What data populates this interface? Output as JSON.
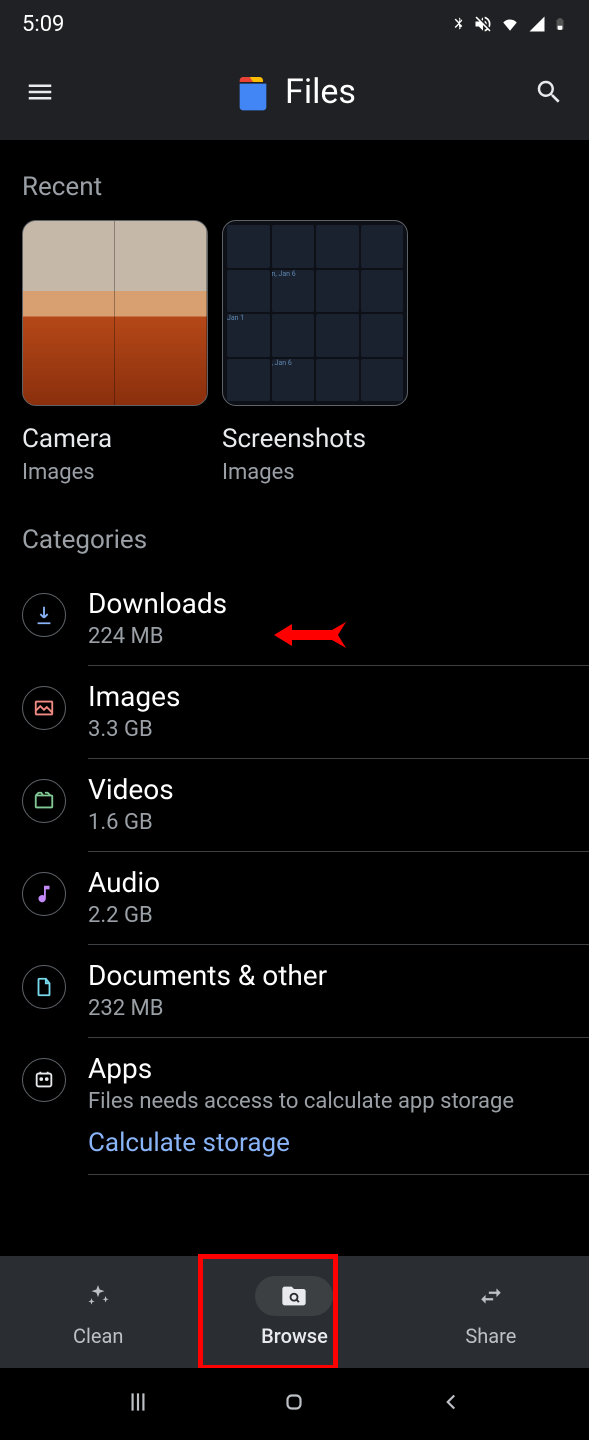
{
  "status": {
    "time": "5:09"
  },
  "appbar": {
    "title": "Files"
  },
  "sections": {
    "recent_title": "Recent",
    "categories_title": "Categories"
  },
  "recent": [
    {
      "name": "Camera",
      "type": "Images"
    },
    {
      "name": "Screenshots",
      "type": "Images"
    }
  ],
  "categories": [
    {
      "name": "Downloads",
      "size": "224 MB",
      "icon": "download-icon",
      "color": "#8ab4f8"
    },
    {
      "name": "Images",
      "size": "3.3 GB",
      "icon": "image-icon",
      "color": "#f28b82"
    },
    {
      "name": "Videos",
      "size": "1.6 GB",
      "icon": "video-icon",
      "color": "#81c995"
    },
    {
      "name": "Audio",
      "size": "2.2 GB",
      "icon": "music-icon",
      "color": "#c58af9"
    },
    {
      "name": "Documents & other",
      "size": "232 MB",
      "icon": "document-icon",
      "color": "#78d9ec"
    },
    {
      "name": "Apps",
      "size": "Files needs access to calculate app storage",
      "icon": "apps-icon",
      "color": "#e8eaed",
      "action": "Calculate storage"
    }
  ],
  "nav": [
    {
      "label": "Clean",
      "icon": "sparkle-icon"
    },
    {
      "label": "Browse",
      "icon": "folder-search-icon",
      "active": true
    },
    {
      "label": "Share",
      "icon": "swap-icon"
    }
  ],
  "annotations": {
    "arrow_target": "Downloads",
    "box_target": "Browse"
  }
}
